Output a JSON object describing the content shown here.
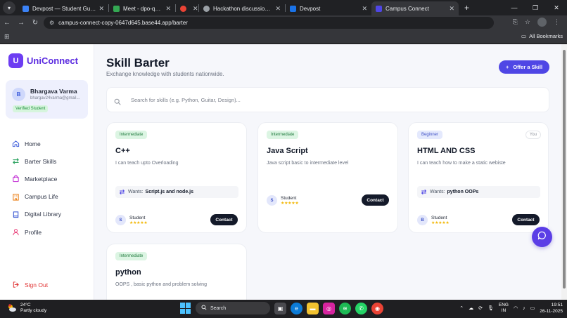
{
  "browser": {
    "tabs": [
      {
        "label": "Devpost — Student Guide for Hackathons",
        "favicon_color": "#3b82f6",
        "active": false
      },
      {
        "label": "Meet - dpo-qcyk-fah",
        "favicon_color": "#34a853",
        "active": false
      },
      {
        "label": "",
        "favicon_color": "#ea4335",
        "active": false
      },
      {
        "label": "Hackathon discussion topics",
        "favicon_color": "#9aa0a6",
        "active": false
      },
      {
        "label": "Devpost",
        "favicon_color": "#1a73e8",
        "active": false
      },
      {
        "label": "Campus Connect",
        "favicon_color": "#4f46e5",
        "active": true
      }
    ],
    "new_tab": "+",
    "url": "campus-connect-copy-0647d645.base44.app/barter",
    "all_bookmarks": "All Bookmarks"
  },
  "sidebar": {
    "brand_initial": "U",
    "brand_name": "UniConnect",
    "user": {
      "initial": "B",
      "name": "Bhargava Varma",
      "email": "bhargav24varma@gmail...",
      "badge": "Verified Student"
    },
    "nav": [
      {
        "label": "Home",
        "icon": "home-icon"
      },
      {
        "label": "Barter Skills",
        "icon": "swap-icon"
      },
      {
        "label": "Marketplace",
        "icon": "bag-icon"
      },
      {
        "label": "Campus Life",
        "icon": "building-icon"
      },
      {
        "label": "Digital Library",
        "icon": "book-icon"
      },
      {
        "label": "Profile",
        "icon": "user-icon"
      }
    ],
    "signout": "Sign Out"
  },
  "main": {
    "title": "Skill Barter",
    "subtitle": "Exchange knowledge with students nationwide.",
    "offer_button": "Offer a Skill",
    "search_placeholder": "Search for skills (e.g. Python, Guitar, Design)...",
    "cards": [
      {
        "level": "Intermediate",
        "title": "C++",
        "desc": "I can teach upto Overloading",
        "wants_label": "Wants:",
        "wants": "Script.js and node.js",
        "owner_initial": "S",
        "owner": "Student",
        "stars": "★★★★★",
        "contact": "Contact"
      },
      {
        "level": "Intermediate",
        "title": "Java Script",
        "desc": "Java script basic to intermediate level",
        "owner_initial": "S",
        "owner": "Student",
        "stars": "★★★★★",
        "contact": "Contact"
      },
      {
        "level": "Beginner",
        "you": "You",
        "title": "HTML AND CSS",
        "desc": "I can teach how to make a static webiste",
        "wants_label": "Wants:",
        "wants": "python OOPs",
        "owner_initial": "B",
        "owner": "Student",
        "stars": "★★★★★",
        "contact": "Contact"
      },
      {
        "level": "Intermediate",
        "title": "python",
        "desc": "OOPS , basic python and problem solving"
      }
    ]
  },
  "taskbar": {
    "temp": "24°C",
    "weather": "Partly cloudy",
    "search": "Search",
    "lang1": "ENG",
    "lang2": "IN",
    "time": "19:51",
    "date": "26-11-2025"
  },
  "colors": {
    "accent": "#4f46e5",
    "brand": "#6d3df2",
    "signout": "#e03131",
    "contact_bg": "#141a2a"
  }
}
